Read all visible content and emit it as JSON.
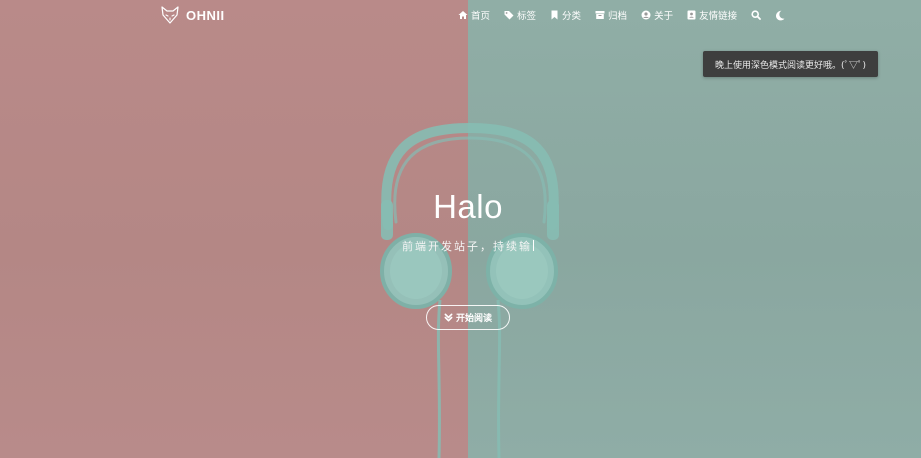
{
  "site": {
    "logo_text": "OHNII"
  },
  "nav": {
    "items": [
      {
        "label": "首页",
        "icon": "home-icon"
      },
      {
        "label": "标签",
        "icon": "tags-icon"
      },
      {
        "label": "分类",
        "icon": "bookmark-icon"
      },
      {
        "label": "归档",
        "icon": "archive-icon"
      },
      {
        "label": "关于",
        "icon": "user-circle-icon"
      },
      {
        "label": "友情链接",
        "icon": "address-book-icon"
      }
    ],
    "search_icon": "search-icon",
    "theme_icon": "moon-icon"
  },
  "toast": {
    "text": "晚上使用深色模式阅读更好哦。(ﾟ▽ﾟ)"
  },
  "hero": {
    "title": "Halo",
    "subtitle": "前端开发站子，持续输",
    "button_label": "开始阅读",
    "button_icon": "chevrons-down-icon"
  },
  "colors": {
    "left_bg": "#b98a89",
    "right_bg": "#8fada6",
    "headphone": "#86bcb3",
    "toast_bg": "#3e3e3e"
  }
}
